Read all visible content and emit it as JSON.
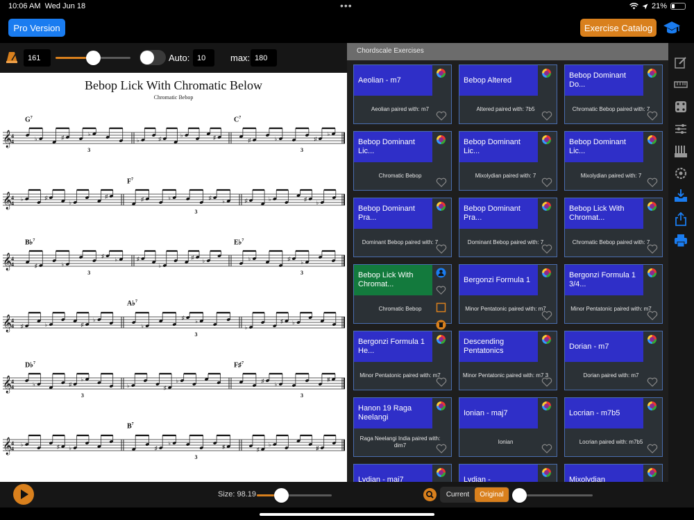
{
  "status": {
    "time": "10:06 AM",
    "date": "Wed Jun 18",
    "dots": "•••",
    "battery": "21%",
    "battery_level": 0.21
  },
  "header": {
    "pro_label": "Pro Version",
    "catalog_label": "Exercise Catalog"
  },
  "tempo": {
    "bpm": "161",
    "auto_label": "Auto:",
    "auto_value": "10",
    "max_label": "max:",
    "max_value": "180",
    "tempo_level": 0.5,
    "auto_on": false
  },
  "score": {
    "title": "Bebop Lick With Chromatic Below",
    "subtitle": "Chromatic Bebop",
    "chords": {
      "g7": {
        "root": "G",
        "ext": "7"
      },
      "c7": {
        "root": "C",
        "ext": "7"
      },
      "f7": {
        "root": "F",
        "ext": "7"
      },
      "bb7": {
        "root": "B♭",
        "ext": "7"
      },
      "eb7": {
        "root": "E♭",
        "ext": "7"
      },
      "ab7": {
        "root": "A♭",
        "ext": "7"
      },
      "db7": {
        "root": "D♭",
        "ext": "7"
      },
      "fs7": {
        "root": "F♯",
        "ext": "7"
      },
      "b7": {
        "root": "B",
        "ext": "7"
      }
    },
    "triplet": "3"
  },
  "panel": {
    "title": "Chordscale Exercises",
    "cards": [
      {
        "title": "Aeolian - m7",
        "desc": "Aeolian paired with: m7",
        "active": false
      },
      {
        "title": "Bebop Altered",
        "desc": "Altered paired with: 7b5",
        "active": false
      },
      {
        "title": "Bebop Dominant Do...",
        "desc": "Chromatic Bebop paired with: 7",
        "active": false
      },
      {
        "title": "Bebop Dominant Lic...",
        "desc": "Chromatic Bebop",
        "active": false
      },
      {
        "title": "Bebop Dominant Lic...",
        "desc": "Mixolydian paired with: 7",
        "active": false
      },
      {
        "title": "Bebop Dominant Lic...",
        "desc": "Mixolydian paired with: 7",
        "active": false
      },
      {
        "title": "Bebop Dominant Pra...",
        "desc": "Dominant Bebop paired with: 7",
        "active": false
      },
      {
        "title": "Bebop Dominant Pra...",
        "desc": "Dominant Bebop paired with: 7",
        "active": false
      },
      {
        "title": "Bebop Lick With Chromat...",
        "desc": "Chromatic Bebop paired with: 7",
        "active": false
      },
      {
        "title": "Bebop Lick With Chromat...",
        "desc": "Chromatic Bebop",
        "active": true
      },
      {
        "title": "Bergonzi Formula 1",
        "desc": "Minor Pentatonic paired with: m7",
        "active": false
      },
      {
        "title": "Bergonzi Formula 1 3/4...",
        "desc": "Minor Pentatonic paired with: m7",
        "active": false
      },
      {
        "title": "Bergonzi Formula 1 He...",
        "desc": "Minor Pentatonic paired with: m7",
        "active": false
      },
      {
        "title": "Descending Pentatonics",
        "desc": "Minor Pentatonic paired with: m7 3",
        "active": false
      },
      {
        "title": "Dorian - m7",
        "desc": "Dorian paired with: m7",
        "active": false
      },
      {
        "title": "Hanon 19 Raga Neelangi",
        "desc": "Raga Neelangi India paired with: dim7",
        "active": false
      },
      {
        "title": "Ionian - maj7",
        "desc": "Ionian",
        "active": false
      },
      {
        "title": "Locrian - m7b5",
        "desc": "Locrian paired with: m7b5",
        "active": false
      },
      {
        "title": "Lydian - maj7",
        "desc": "",
        "active": false
      },
      {
        "title": "Lydian -",
        "desc": "",
        "active": false
      },
      {
        "title": "Mixolydian",
        "desc": "",
        "active": false
      }
    ]
  },
  "bottom": {
    "size_label": "Size: 98.19",
    "size_level": 0.32,
    "seg_current": "Current",
    "seg_original": "Original",
    "speed_level": 0.0
  },
  "colors": {
    "accent": "#d9801d",
    "card_head": "#2f2fc8",
    "card_active": "#137a3d",
    "pro_button": "#1a7cf0"
  }
}
